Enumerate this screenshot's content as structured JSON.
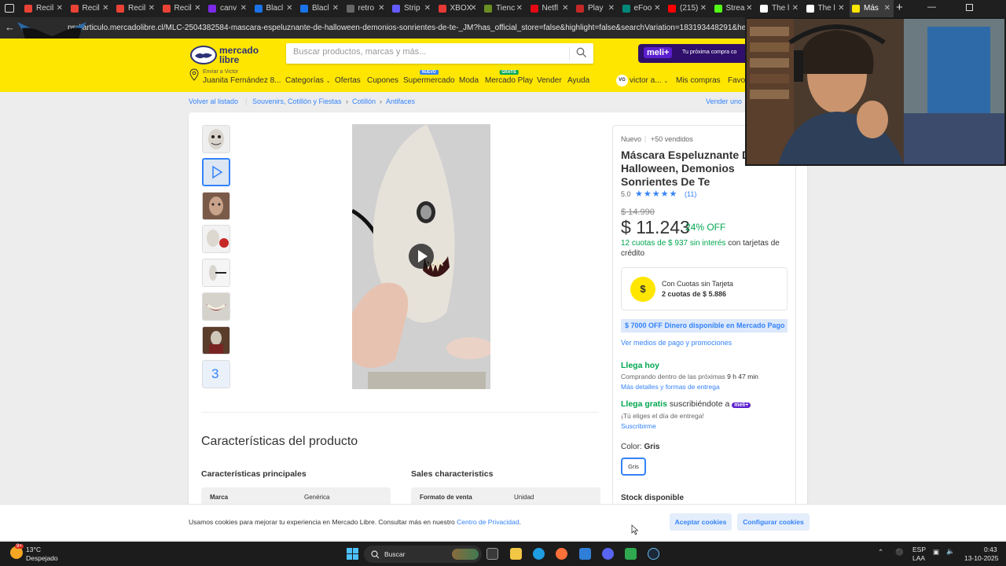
{
  "browser": {
    "tabs": [
      {
        "label": "Recil",
        "color": "#ea4335"
      },
      {
        "label": "Recil",
        "color": "#ea4335"
      },
      {
        "label": "Recil",
        "color": "#ea4335"
      },
      {
        "label": "Recil",
        "color": "#ea4335"
      },
      {
        "label": "canv",
        "color": "#7d2ae8"
      },
      {
        "label": "Blacl",
        "color": "#1a73e8"
      },
      {
        "label": "Blacl",
        "color": "#1a73e8"
      },
      {
        "label": "retro",
        "color": "#666666"
      },
      {
        "label": "Strip",
        "color": "#635bff"
      },
      {
        "label": "XBOX",
        "color": "#e53935"
      },
      {
        "label": "Tienc",
        "color": "#6b8e23"
      },
      {
        "label": "Netfl",
        "color": "#e50914"
      },
      {
        "label": "Play",
        "color": "#c62828"
      },
      {
        "label": "eFoo",
        "color": "#00897b"
      },
      {
        "label": "(215)",
        "color": "#ff0000"
      },
      {
        "label": "Strea",
        "color": "#53fc18"
      },
      {
        "label": "The l",
        "color": "#ffffff"
      },
      {
        "label": "The l",
        "color": "#ffffff"
      },
      {
        "label": "Más",
        "color": "#ffe600"
      }
    ],
    "url": "ps://articulo.mercadolibre.cl/MLC-2504382584-mascara-espeluznante-de-halloween-demonios-sonrientes-de-te-_JM?has_official_store=false&highlight=false&searchVariation=183193448291&headerTopBrand"
  },
  "header": {
    "logo_line1": "mercado",
    "logo_line2": "libre",
    "search_placeholder": "Buscar productos, marcas y más...",
    "meli_badge": "meli+",
    "meli_text": "Tu próxima compra co",
    "deliver_small": "Enviar a Victor",
    "deliver_big": "Juanita Fernández 8...",
    "nav": {
      "categorias": "Categorías",
      "ofertas": "Ofertas",
      "cupones": "Cupones",
      "supermercado": "Supermercado",
      "supermercado_badge": "NUEVO",
      "moda": "Moda",
      "mercadoplay": "Mercado Play",
      "mercadoplay_badge": "GRATIS",
      "vender": "Vender",
      "ayuda": "Ayuda",
      "avatar": "VG",
      "user": "victor a...",
      "miscompras": "Mis compras",
      "favoritos": "Favori"
    },
    "brand_yellow": "#ffe600"
  },
  "breadcrumb": {
    "back": "Volver al listado",
    "items": [
      "Souvenirs, Cotillón y Fiestas",
      "Cotillón",
      "Antifaces"
    ],
    "sell_similar": "Vender uno"
  },
  "gallery": {
    "more_count": "3"
  },
  "product": {
    "condition": "Nuevo",
    "sold": "+50 vendidos",
    "title": "Máscara Espeluznante De Halloween, Demonios Sonrientes De Te",
    "rating": "5.0",
    "reviews": "(11)",
    "old_price": "$ 14.990",
    "price": "$ 11.243",
    "discount": "24% OFF",
    "installments_green": "12 cuotas de $ 937 sin interés",
    "installments_rest": " con tarjetas de crédito",
    "cuotas_title": "Con Cuotas sin Tarjeta",
    "cuotas_detail": "2 cuotas de $ 5.886",
    "mp_banner": "$ 7000 OFF Dinero disponible en Mercado Pago",
    "payment_link": "Ver medios de pago y promociones",
    "arrives_today": "Llega hoy",
    "arrives_within": "Comprando dentro de las próximas ",
    "arrives_time": "9 h 47 min",
    "arrives_link": "Más detalles y formas de entrega",
    "free_green": "Llega gratis",
    "free_rest": " suscribiéndote a",
    "free_badge": "meli+",
    "choose_day": "¡Tú eliges el día de entrega!",
    "subscribe": "Suscribirme",
    "color_label": "Color: ",
    "color_value": "Gris",
    "color_option": "Gris",
    "stock": "Stock disponible",
    "green": "#00a650",
    "blue": "#3483fa"
  },
  "specs": {
    "title": "Características del producto",
    "main_title": "Características principales",
    "sales_title": "Sales characteristics",
    "main_row_key": "Marca",
    "main_row_value": "Genérica",
    "sales_row_key": "Formato de venta",
    "sales_row_value": "Unidad"
  },
  "cookie": {
    "message": "Usamos cookies para mejorar tu experiencia en Mercado Libre. Consultar más en nuestro ",
    "link": "Centro de Privacidad",
    "accept": "Aceptar cookies",
    "configure": "Configurar cookies"
  },
  "taskbar": {
    "weather_temp": "13°C",
    "weather_desc": "Despejado",
    "weather_badge": "9+",
    "search": "Buscar",
    "lang1": "ESP",
    "lang2": "LAA",
    "time": "0:43",
    "date": "13-10-2025"
  }
}
